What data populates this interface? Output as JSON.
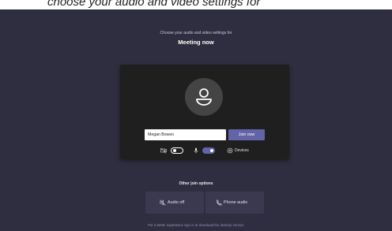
{
  "banner": {
    "text": "choose your audio and video settings for"
  },
  "header": {
    "prompt": "Choose your audio and video settings for",
    "meeting_title": "Meeting now"
  },
  "preview": {
    "avatar_icon": "person-icon",
    "name_value": "Megan Bowen",
    "join_label": "Join now",
    "camera": {
      "icon": "camera-off-icon",
      "state": "off"
    },
    "microphone": {
      "icon": "microphone-icon",
      "state": "on"
    },
    "devices_icon": "gear-icon",
    "devices_label": "Devices"
  },
  "other": {
    "heading": "Other join options",
    "audio_off": {
      "icon": "speaker-off-icon",
      "label": "Audio off"
    },
    "phone_audio": {
      "icon": "phone-icon",
      "label": "Phone audio"
    }
  },
  "footer": {
    "prefix": "For a better experience",
    "link1": "sign in",
    "middle": "or",
    "link2": "download the desktop version"
  },
  "colors": {
    "background": "#2f2e40",
    "card": "#1f1f1f",
    "accent": "#6264a7",
    "option_box": "#3a3950"
  }
}
